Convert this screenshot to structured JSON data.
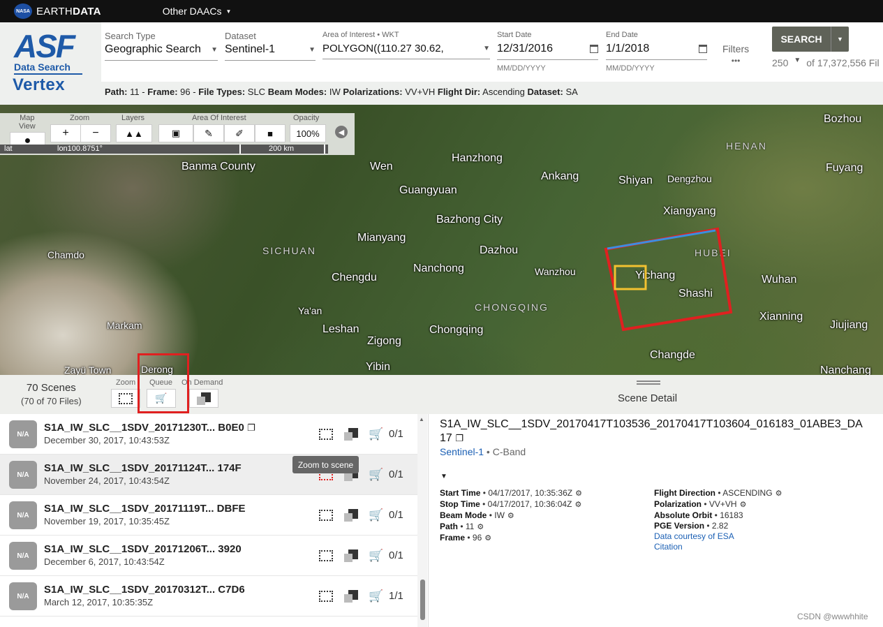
{
  "topbar": {
    "brand_light": "EARTH",
    "brand_bold": "DATA",
    "nasa": "NASA",
    "other_daacs": "Other DAACs"
  },
  "logo": {
    "asf": "ASF",
    "data_search": "Data Search",
    "vertex": "Vertex"
  },
  "search": {
    "search_type_label": "Search Type",
    "search_type_value": "Geographic Search",
    "dataset_label": "Dataset",
    "dataset_value": "Sentinel-1",
    "aoi_label": "Area of Interest • WKT",
    "aoi_value": "POLYGON((110.27 30.62,",
    "start_label": "Start Date",
    "start_value": "12/31/2016",
    "start_hint": "MM/DD/YYYY",
    "end_label": "End Date",
    "end_value": "1/1/2018",
    "end_hint": "MM/DD/YYYY",
    "filters_label": "Filters",
    "filters_dots": "•••",
    "search_button": "SEARCH",
    "max_results": "250",
    "of_total": "of 17,372,556 Fil"
  },
  "crumbs": {
    "path_label": "Path:",
    "path_value": "11 -",
    "frame_label": "Frame:",
    "frame_value": "96 -",
    "filetypes_label": "File Types:",
    "filetypes_value": "SLC",
    "beam_label": "Beam Modes:",
    "beam_value": "IW",
    "pol_label": "Polarizations:",
    "pol_value": "VV+VH",
    "dir_label": "Flight Dir:",
    "dir_value": "Ascending",
    "dataset_label": "Dataset:",
    "dataset_value": "SA"
  },
  "maptools": {
    "map_view": "Map\nView",
    "zoom": "Zoom",
    "layers": "Layers",
    "aoi": "Area Of Interest",
    "opacity": "Opacity",
    "opacity_value": "100%",
    "lon": "lon100.8751°",
    "lat": "lat",
    "scale": "200 km"
  },
  "map": {
    "cities": [
      "Bozhou",
      "Banma County",
      "Wen",
      "Hanzhong",
      "Ankang",
      "Shiyan",
      "Dengzhou",
      "Fuyang",
      "Guangyuan",
      "Xiangyang",
      "Bazhong City",
      "Mianyang",
      "Dazhou",
      "Nanchong",
      "Wanzhou",
      "Chamdo",
      "Chengdu",
      "Yichang",
      "Shashi",
      "Wuhan",
      "Ya'an",
      "Xianning",
      "Jiujiang",
      "Markam",
      "Leshan",
      "Chongqing",
      "Zigong",
      "Changde",
      "Yibin",
      "Derong",
      "Nanchang",
      "Zayü Town"
    ],
    "regions": [
      "HENAN",
      "SICHUAN",
      "HUBEI",
      "CHONGQING"
    ]
  },
  "results": {
    "scenes_count": "70 Scenes",
    "files_count": "(70 of 70 Files)",
    "zoom_label": "Zoom",
    "queue_label": "Queue",
    "on_demand_label": "On Demand",
    "scene_detail_title": "Scene Detail",
    "tooltip": "Zoom to scene",
    "rows": [
      {
        "thumb": "N/A",
        "name": "S1A_IW_SLC__1SDV_20171230T... B0E0",
        "date": "December 30, 2017, 10:43:53Z",
        "count": "0/1"
      },
      {
        "thumb": "N/A",
        "name": "S1A_IW_SLC__1SDV_20171124T... 174F",
        "date": "November 24, 2017, 10:43:54Z",
        "count": "0/1"
      },
      {
        "thumb": "N/A",
        "name": "S1A_IW_SLC__1SDV_20171119T... DBFE",
        "date": "November 19, 2017, 10:35:45Z",
        "count": "0/1"
      },
      {
        "thumb": "N/A",
        "name": "S1A_IW_SLC__1SDV_20171206T... 3920",
        "date": "December 6, 2017, 10:43:54Z",
        "count": "0/1"
      },
      {
        "thumb": "N/A",
        "name": "S1A_IW_SLC__1SDV_20170312T... C7D6",
        "date": "March 12, 2017, 10:35:35Z",
        "count": "1/1"
      }
    ]
  },
  "detail": {
    "name": "S1A_IW_SLC__1SDV_20170417T103536_20170417T103604_016183_01ABE3_DA17",
    "dataset": "Sentinel-1",
    "band": " • C-Band",
    "start_label": "Start Time",
    "start_value": " • 04/17/2017, 10:35:36Z",
    "stop_label": "Stop Time",
    "stop_value": " • 04/17/2017, 10:36:04Z",
    "beam_label": "Beam Mode",
    "beam_value": " • IW",
    "path_label": "Path",
    "path_value": " • 11",
    "frame_label": "Frame",
    "frame_value": " • 96",
    "dir_label": "Flight Direction",
    "dir_value": " • ASCENDING",
    "pol_label": "Polarization",
    "pol_value": " • VV+VH",
    "orbit_label": "Absolute Orbit",
    "orbit_value": " • 16183",
    "pge_label": "PGE Version",
    "pge_value": " • 2.82",
    "courtesy": "Data courtesy of ESA",
    "citation": "Citation"
  },
  "watermark": "CSDN @wwwhhite",
  "colors": {
    "accent_red": "#e02020",
    "search_button": "#5f6258",
    "link_blue": "#1a5fb4",
    "aoi_yellow": "#f2c230"
  }
}
